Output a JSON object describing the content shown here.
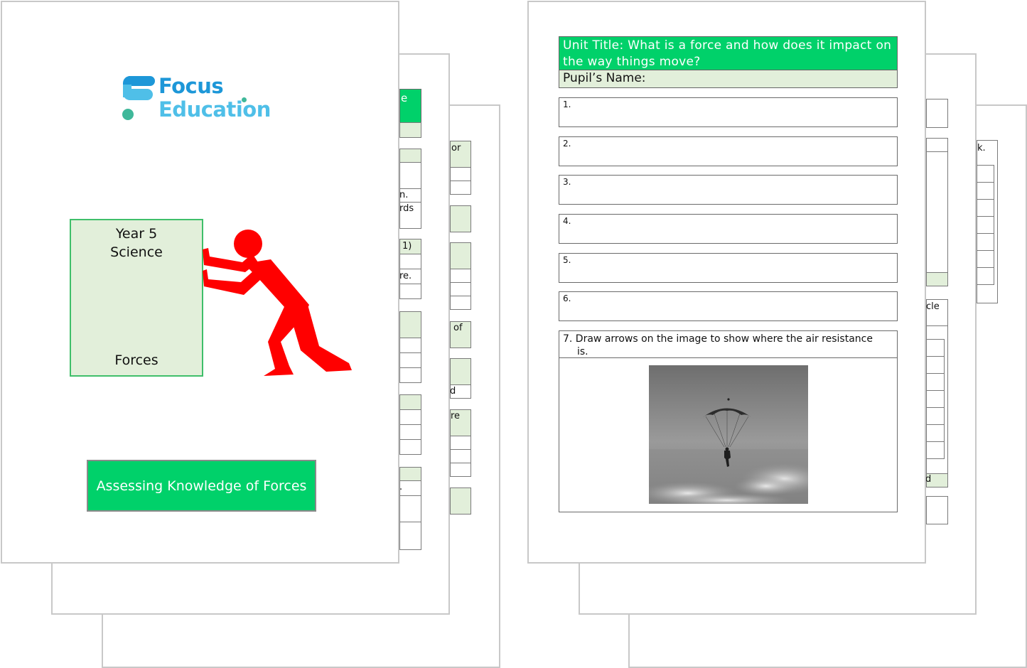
{
  "cover": {
    "logo": {
      "line1": "Focus",
      "line2": "Education",
      "colors": {
        "dark_blue": "#1d97d8",
        "light_blue": "#4fbfe8",
        "teal": "#3fb89a"
      }
    },
    "subject_box": {
      "year": "Year 5",
      "subject": "Science",
      "topic": "Forces"
    },
    "title_banner": "Assessing Knowledge of Forces",
    "figure": "red stick figure pushing box",
    "accent_color": "#00d16a",
    "figure_color": "#ff0000"
  },
  "peek_left_mid": {
    "snippets": [
      "e",
      "n.",
      "rds",
      "1)",
      "re.",
      "."
    ]
  },
  "peek_left_back": {
    "snippets": [
      "or",
      "of",
      "d",
      "re"
    ]
  },
  "worksheet": {
    "unit_title": "Unit Title:  What is a force and how does it impact on the way things move?",
    "pupil_name_label": "Pupil’s Name:",
    "questions": [
      {
        "number": "1."
      },
      {
        "number": "2."
      },
      {
        "number": "3."
      },
      {
        "number": "4."
      },
      {
        "number": "5."
      },
      {
        "number": "6."
      }
    ],
    "question7": {
      "text_line1": "7. Draw arrows on the image to show where the air resistance",
      "text_line2": "is.",
      "image": "parachutist above clouds (black and white photo)"
    }
  },
  "peek_right_mid": {
    "snippets": [
      "cle",
      "d"
    ]
  },
  "peek_right_back": {
    "snippets": [
      "k."
    ]
  }
}
